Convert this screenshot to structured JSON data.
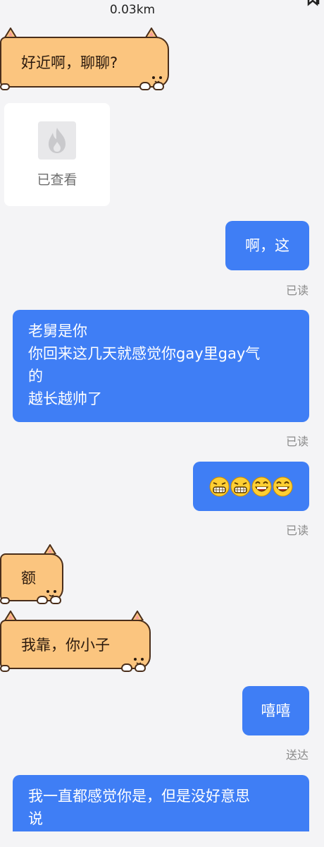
{
  "header": {
    "distance": "0.03km"
  },
  "messages": [
    {
      "side": "in",
      "style": "corgi",
      "text": "好近啊，聊聊?"
    },
    {
      "side": "in",
      "style": "burn-card",
      "label": "已查看"
    },
    {
      "side": "out",
      "text": "啊，这",
      "status": "已读"
    },
    {
      "side": "out",
      "lines": [
        "老舅是你",
        "你回来这几天就感觉你gay里gay气",
        "的",
        "越长越帅了"
      ],
      "status": "已读"
    },
    {
      "side": "out",
      "emoji": [
        "grin-emoji",
        "grin-emoji",
        "laugh-emoji",
        "laugh-emoji"
      ],
      "status": "已读"
    },
    {
      "side": "in",
      "style": "corgi",
      "text": "额"
    },
    {
      "side": "in",
      "style": "corgi",
      "text": "我靠，你小子"
    },
    {
      "side": "out",
      "text": "嘻嘻",
      "status": "送达"
    },
    {
      "side": "out",
      "lines": [
        "我一直都感觉你是，但是没好意思",
        "说"
      ]
    }
  ],
  "colors": {
    "background": "#f4f4f6",
    "outgoing_bubble": "#3f7ef5",
    "corgi_bubble": "#fbc57f",
    "status_text": "#8a8a8a"
  }
}
